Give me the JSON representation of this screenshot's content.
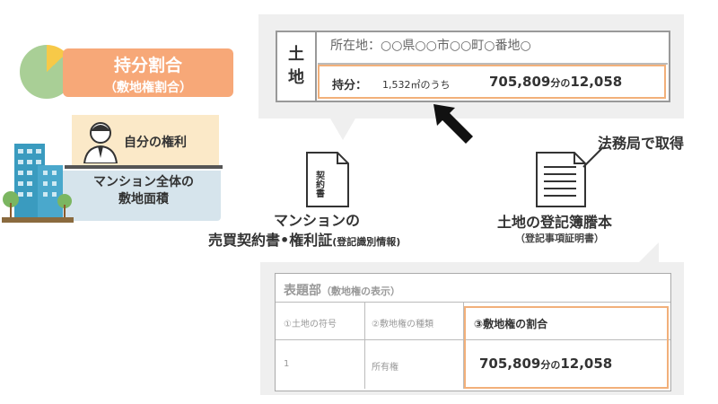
{
  "left": {
    "title": "持分割合",
    "subtitle": "（敷地権割合）",
    "own_right": "自分の権利",
    "site_area_line1": "マンション全体の",
    "site_area_line2": "敷地面積"
  },
  "land_record": {
    "head_line1": "土",
    "head_line2": "地",
    "location": "所在地：○○県○○市○○町○番地○",
    "share_label": "持分：",
    "share_area": "1,532㎡のうち",
    "share_numerator": "705,809",
    "share_of": "分の",
    "share_denominator": "12,058"
  },
  "contract_doc": {
    "icon_text": "契約書",
    "caption_line1": "マンションの",
    "caption_line2": "売買契約書•権利証",
    "caption_line2_small": "(登記識別情報)"
  },
  "registry_doc": {
    "obtain_note": "法務局で取得",
    "caption_line1": "土地の登記簿謄本",
    "caption_line2": "（登記事項証明書）"
  },
  "registry_table": {
    "section_title": "表題部",
    "section_sub": "（敷地権の表示）",
    "col1": "①土地の符号",
    "col2": "②敷地権の種類",
    "col3": "③敷地権の割合",
    "val1": "1",
    "val2": "所有権",
    "val3_num": "705,809",
    "val3_of": "分の",
    "val3_den": "12,058"
  },
  "colors": {
    "accent_orange": "#f7a878",
    "highlight_border": "#f2b07a",
    "pie_green": "#a9cf96",
    "pie_yellow": "#f7c948"
  }
}
